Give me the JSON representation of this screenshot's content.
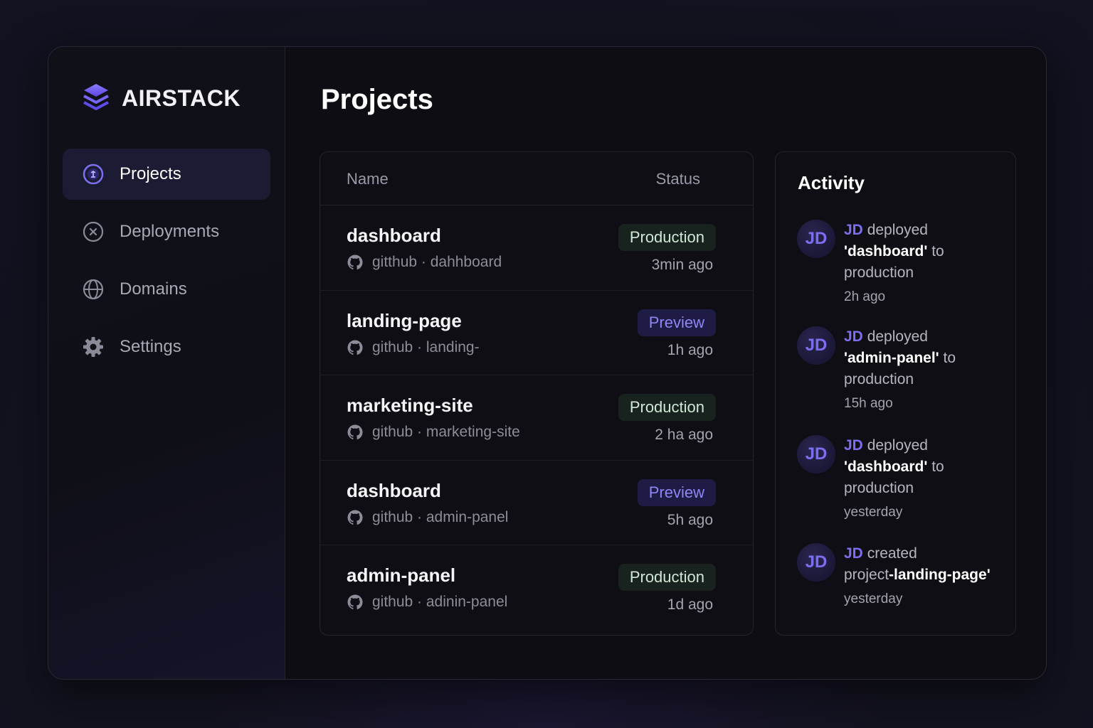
{
  "brand": {
    "name": "AIRSTACK",
    "logo_icon": "stack-layers-icon"
  },
  "sidebar": {
    "items": [
      {
        "label": "Projects",
        "icon": "projects-icon",
        "active": true
      },
      {
        "label": "Deployments",
        "icon": "deployments-icon",
        "active": false
      },
      {
        "label": "Domains",
        "icon": "globe-icon",
        "active": false
      },
      {
        "label": "Settings",
        "icon": "gear-icon",
        "active": false
      }
    ]
  },
  "main": {
    "title": "Projects"
  },
  "table": {
    "headers": {
      "name": "Name",
      "status": "Status"
    },
    "rows": [
      {
        "name": "dashboard",
        "repo": "gitthub · dahhboard",
        "status": "Production",
        "status_type": "prod",
        "time": "3min ago"
      },
      {
        "name": "landing-page",
        "repo": "github · landing-",
        "status": "Preview",
        "status_type": "prev",
        "time": "1h ago"
      },
      {
        "name": "marketing-site",
        "repo": "github · marketing-site",
        "status": "Production",
        "status_type": "prod",
        "time": "2 ha ago"
      },
      {
        "name": "dashboard",
        "repo": "github · admin-panel",
        "status": "Preview",
        "status_type": "prev",
        "time": "5h ago"
      },
      {
        "name": "admin-panel",
        "repo": "github · adinin-panel",
        "status": "Production",
        "status_type": "prod",
        "time": "1d ago"
      }
    ]
  },
  "activity": {
    "title": "Activity",
    "items": [
      {
        "avatar": "JD",
        "user": "JD",
        "action": "deployed",
        "target": "'dashboard'",
        "suffix": "to production",
        "time": "2h ago"
      },
      {
        "avatar": "JD",
        "user": "JD",
        "action": "deployed",
        "target": "'admin-panel'",
        "suffix": "to production",
        "time": "15h ago"
      },
      {
        "avatar": "JD",
        "user": "JD",
        "action": "deployed",
        "target": "'dashboard'",
        "suffix": "to production",
        "time": "yesterday"
      },
      {
        "avatar": "JD",
        "user": "JD",
        "action": "created",
        "prefix": "project",
        "target": "-landing-page'",
        "time": "yesterday"
      }
    ]
  },
  "colors": {
    "accent": "#7b6ff0",
    "production_badge_bg": "#18221e",
    "preview_badge_bg": "#1e1c44",
    "background": "#0d0d13"
  }
}
